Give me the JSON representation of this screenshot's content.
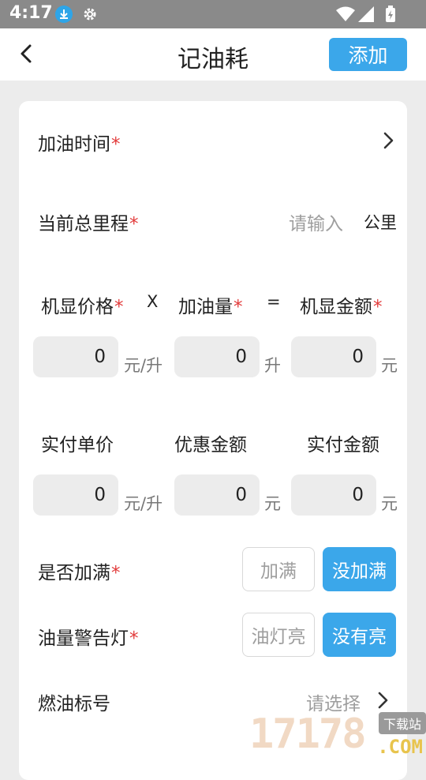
{
  "status_bar": {
    "time": "4:17"
  },
  "header": {
    "title": "记油耗",
    "add_label": "添加"
  },
  "form": {
    "refuel_time": {
      "label": "加油时间",
      "required_mark": "*"
    },
    "odometer": {
      "label": "当前总里程",
      "required_mark": "*",
      "placeholder": "请输入",
      "unit": "公里"
    },
    "calc": {
      "price_label": "机显价格",
      "price_required": "*",
      "times": "X",
      "volume_label": "加油量",
      "volume_required": "*",
      "equals": "=",
      "amount_label": "机显金额",
      "amount_required": "*",
      "price_value": "0",
      "price_unit": "元/升",
      "volume_value": "0",
      "volume_unit": "升",
      "amount_value": "0",
      "amount_unit": "元"
    },
    "paid": {
      "unit_price_label": "实付单价",
      "discount_label": "优惠金额",
      "paid_amount_label": "实付金额",
      "unit_price_value": "0",
      "unit_price_unit": "元/升",
      "discount_value": "0",
      "discount_unit": "元",
      "paid_amount_value": "0",
      "paid_amount_unit": "元"
    },
    "full_tank": {
      "label": "是否加满",
      "required_mark": "*",
      "option_yes": "加满",
      "option_no": "没加满",
      "selected": "没加满"
    },
    "warning_light": {
      "label": "油量警告灯",
      "required_mark": "*",
      "option_on": "油灯亮",
      "option_off": "没有亮",
      "selected": "没有亮"
    },
    "fuel_grade": {
      "label": "燃油标号",
      "placeholder": "请选择"
    }
  },
  "watermark": {
    "text": "17178",
    "tag": "下载站",
    "suffix": ".COM"
  },
  "colors": {
    "accent": "#3ba7ea",
    "required": "#e23b3b",
    "status_bar": "#8a8a8a"
  }
}
